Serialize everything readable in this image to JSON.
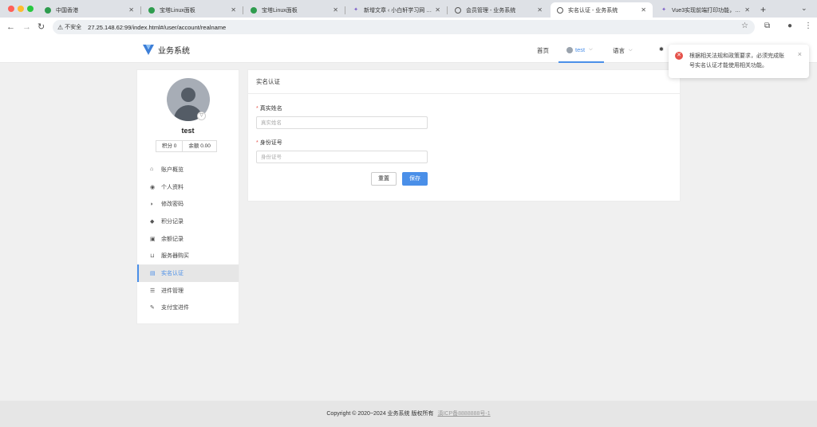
{
  "browser": {
    "tabs": [
      {
        "label": "中国香港",
        "icon": "shield-icon"
      },
      {
        "label": "宝塔Linux面板",
        "icon": "shield-icon"
      },
      {
        "label": "宝塔Linux面板",
        "icon": "shield-icon"
      },
      {
        "label": "新增文章 ‹ 小白轩学习网 — Wo",
        "icon": "wordpress-icon"
      },
      {
        "label": "会员管理 - 业务系统",
        "icon": "globe-icon"
      },
      {
        "label": "实名认证 - 业务系统",
        "icon": "globe-icon"
      },
      {
        "label": "Vue3实现前端打印功能，10分",
        "icon": "vue-icon"
      }
    ],
    "security_label": "不安全",
    "url": "27.25.148.62:99/index.html#/user/account/realname"
  },
  "header": {
    "app_name": "业务系统",
    "nav_home": "首页",
    "nav_user": "test",
    "nav_language": "语言",
    "extra": "✱"
  },
  "profile": {
    "username": "test",
    "points_label": "积分 0",
    "balance_label": "余额 0.00"
  },
  "sidebar": {
    "items": [
      {
        "label": "账户概览",
        "icon": "home-icon"
      },
      {
        "label": "个人资料",
        "icon": "user-circle-icon"
      },
      {
        "label": "修改密码",
        "icon": "shield-icon"
      },
      {
        "label": "积分记录",
        "icon": "tag-icon"
      },
      {
        "label": "余额记录",
        "icon": "money-icon"
      },
      {
        "label": "服务器购买",
        "icon": "cart-icon"
      },
      {
        "label": "实名认证",
        "icon": "id-card-icon"
      },
      {
        "label": "进件管理",
        "icon": "list-icon"
      },
      {
        "label": "支付宝进件",
        "icon": "edit-icon"
      }
    ],
    "active_index": 6
  },
  "form": {
    "title": "实名认证",
    "name_label": "真实姓名",
    "name_placeholder": "真实姓名",
    "name_value": "",
    "id_label": "身份证号",
    "id_placeholder": "身份证号",
    "id_value": "",
    "reset_label": "重置",
    "save_label": "保存"
  },
  "footer": {
    "copyright": "Copyright © 2020~2024 业务系统 版权所有",
    "icp": "滇ICP备8888888号-1"
  },
  "toast": {
    "message": "根据相关法规和政策要求，必须完成账号实名认证才能使用相关功能。"
  },
  "colors": {
    "accent": "#4a8fe8",
    "error": "#e5534b"
  }
}
